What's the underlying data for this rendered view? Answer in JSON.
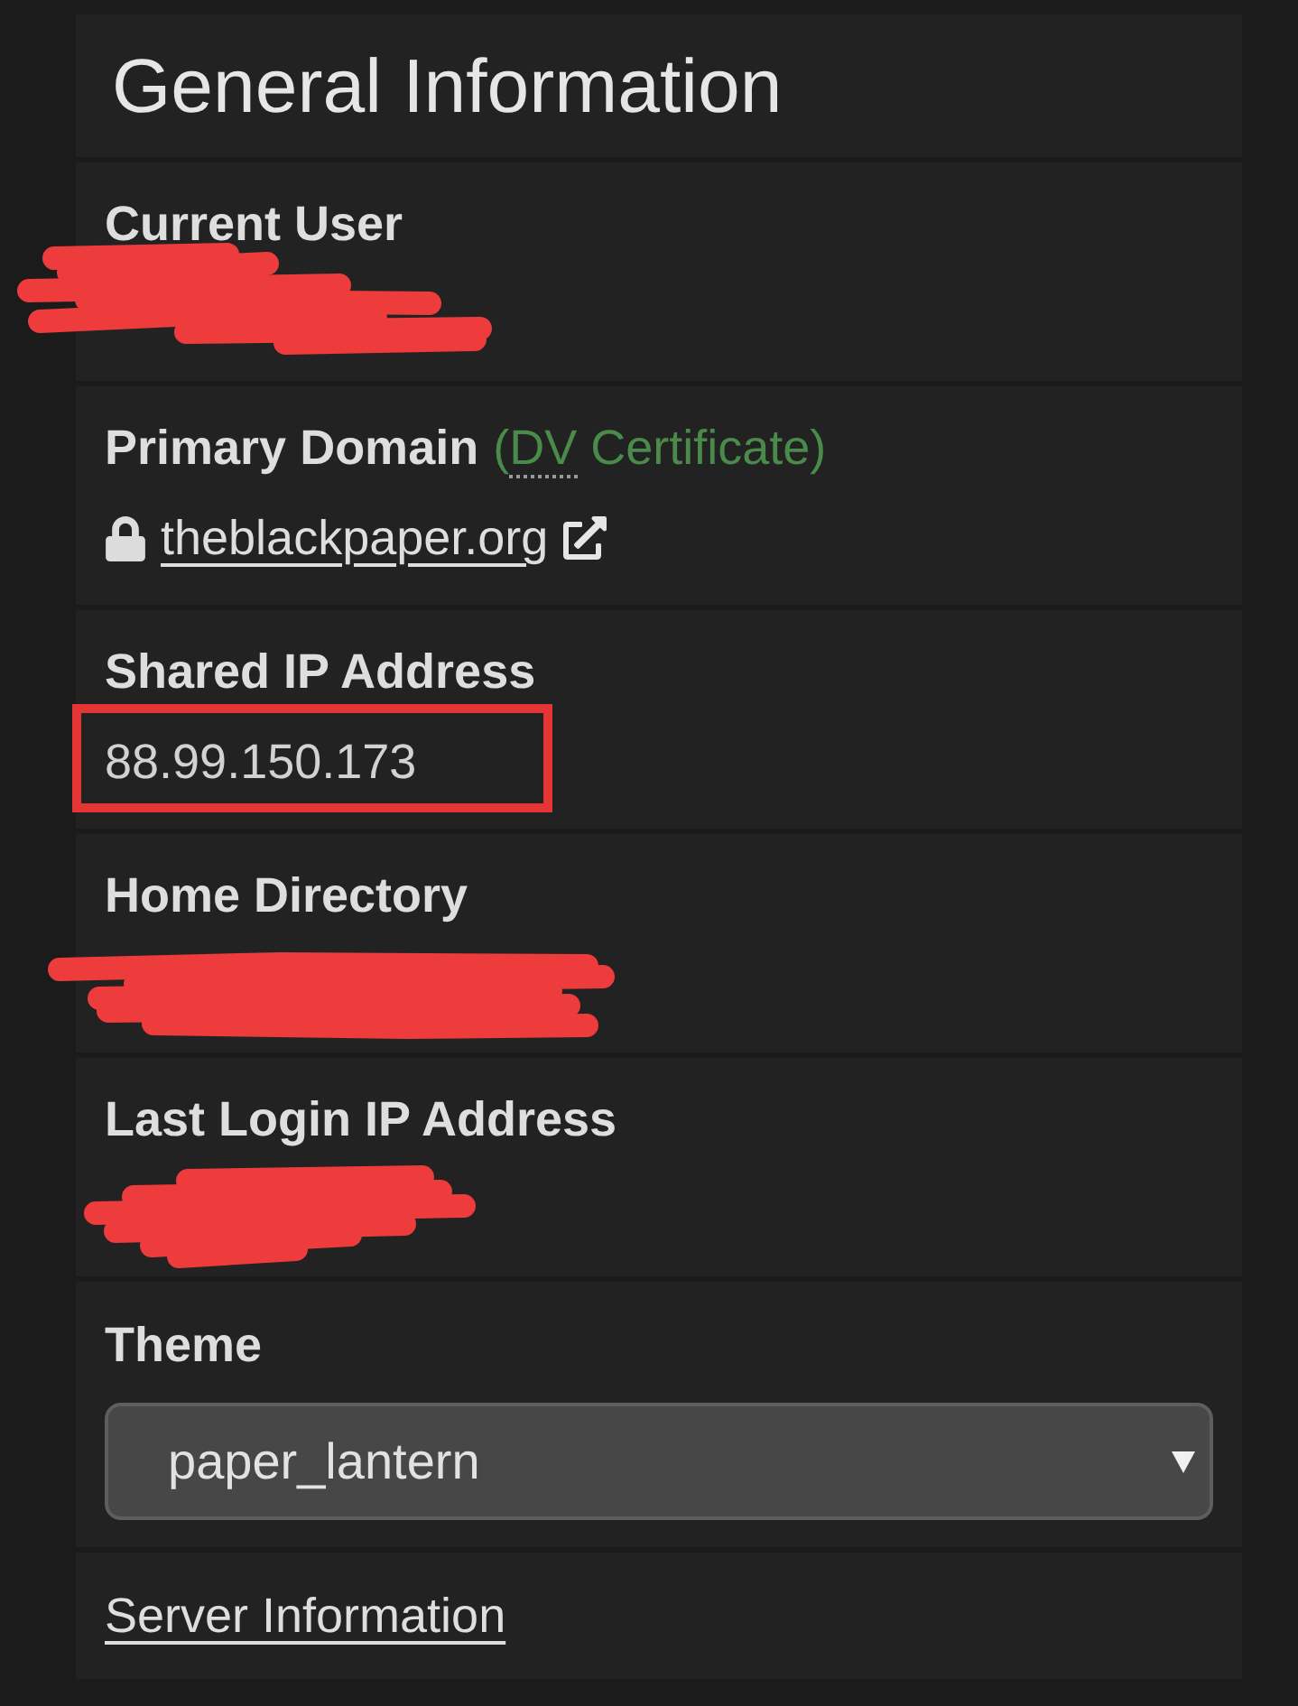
{
  "panel": {
    "title": "General Information"
  },
  "fields": [
    {
      "kind": "text",
      "label": "Current User",
      "redacted": true
    },
    {
      "kind": "domain",
      "label": "Primary Domain",
      "certificate": {
        "before": "(",
        "abbr": "DV",
        "after": " Certificate)"
      },
      "link": "theblackpaper.org"
    },
    {
      "kind": "text",
      "label": "Shared IP Address",
      "value": "88.99.150.173",
      "highlighted": true
    },
    {
      "kind": "text",
      "label": "Home Directory",
      "redacted": true
    },
    {
      "kind": "text",
      "label": "Last Login IP Address",
      "redacted": true
    },
    {
      "kind": "select",
      "label": "Theme",
      "value": "paper_lantern"
    },
    {
      "kind": "link",
      "text": "Server Information"
    }
  ]
}
